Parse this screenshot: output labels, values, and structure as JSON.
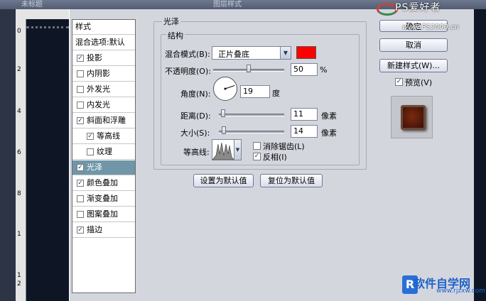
{
  "window": {
    "doc_tab": "未标题",
    "title": "图层样式"
  },
  "watermark": {
    "top": "PS爱好者",
    "top_url": "www.PS2000.cn",
    "bottom": "软件自学网",
    "bottom_url": "www.rjzxw.com"
  },
  "ruler": {
    "v_marks": [
      "0",
      "2",
      "4",
      "6",
      "8",
      "1",
      "1",
      "2"
    ]
  },
  "styles": {
    "header": "样式",
    "blend_options": "混合选项:默认",
    "items": [
      {
        "label": "投影",
        "checked": true
      },
      {
        "label": "内阴影",
        "checked": false
      },
      {
        "label": "外发光",
        "checked": false
      },
      {
        "label": "内发光",
        "checked": false
      },
      {
        "label": "斜面和浮雕",
        "checked": true
      },
      {
        "label": "等高线",
        "checked": true
      },
      {
        "label": "纹理",
        "checked": false
      },
      {
        "label": "光泽",
        "checked": true
      },
      {
        "label": "颜色叠加",
        "checked": true
      },
      {
        "label": "渐变叠加",
        "checked": false
      },
      {
        "label": "图案叠加",
        "checked": false
      },
      {
        "label": "描边",
        "checked": true
      }
    ],
    "selected": "光泽"
  },
  "satin": {
    "group_title": "光泽",
    "structure_title": "结构",
    "blend_mode_label": "混合模式(B):",
    "blend_mode_value": "正片叠底",
    "color": "#ff0000",
    "opacity_label": "不透明度(O):",
    "opacity_value": "50",
    "opacity_unit": "%",
    "opacity_fraction": 0.5,
    "angle_label": "角度(N):",
    "angle_value": "19",
    "angle_unit": "度",
    "distance_label": "距离(D):",
    "distance_value": "11",
    "distance_unit": "像素",
    "size_label": "大小(S):",
    "size_value": "14",
    "size_unit": "像素",
    "contour_label": "等高线:",
    "antialias_label": "消除锯齿(L)",
    "antialias_checked": false,
    "invert_label": "反相(I)",
    "invert_checked": true,
    "make_default": "设置为默认值",
    "reset_default": "复位为默认值"
  },
  "buttons": {
    "ok": "确定",
    "cancel": "取消",
    "new_style": "新建样式(W)...",
    "preview": "预览(V)",
    "preview_checked": true
  }
}
